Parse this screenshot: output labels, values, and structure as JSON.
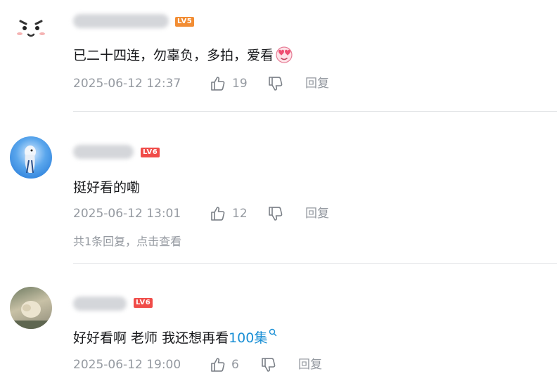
{
  "comments": [
    {
      "level_label": "LV5",
      "level_color": "#f28d34",
      "text": "已二十四连，勿辜负，多拍，爱看",
      "emoji": "heart-eyes-emoji",
      "timestamp": "2025-06-12 12:37",
      "likes": "19",
      "reply_label": "回复"
    },
    {
      "level_label": "LV6",
      "level_color": "#f04c49",
      "text": "挺好看的嘞",
      "timestamp": "2025-06-12 13:01",
      "likes": "12",
      "reply_label": "回复",
      "replies_summary": "共1条回复，点击查看"
    },
    {
      "level_label": "LV6",
      "level_color": "#f04c49",
      "text_prefix": "好好看啊 老师 我还想再看",
      "text_link": "100集",
      "timestamp": "2025-06-12 19:00",
      "likes": "6",
      "reply_label": "回复"
    }
  ],
  "icons": [
    "like-icon",
    "dislike-icon",
    "search-icon"
  ],
  "colors": {
    "link": "#1a8fd5",
    "meta": "#9499a0"
  }
}
